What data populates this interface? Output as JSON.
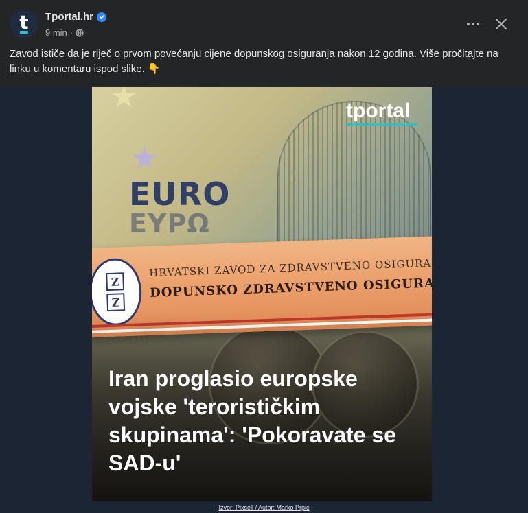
{
  "post": {
    "author": "Tportal.hr",
    "avatar_letter": "t",
    "time": "9 min",
    "audience": "globe-icon",
    "text": "Zavod ističe da je riječ o prvom povećanju cijene dopunskog osiguranja nakon 12 godina. Više pročitajte na linku u komentaru ispod slike. 👇",
    "more_label": "•••",
    "close_label": "×"
  },
  "image": {
    "brand": "tportal",
    "banknote_word": "EURO",
    "banknote_word_greek": "ΕΥΡΩ",
    "card_line1": "HRVATSKI ZAVOD ZA ZDRAVSTVENO OSIGURAN",
    "card_line2": "DOPUNSKO ZDRAVSTVENO OSIGURAN",
    "card_logo": [
      "Z",
      "Z"
    ],
    "headline": "Iran proglasio europske vojske 'terorističkim skupinama': 'Pokoravate se SAD-u'",
    "credit": "Izvor: Pixsell / Autor: Marko Prpic"
  },
  "colors": {
    "background": "#242526",
    "media_background": "#1c2533",
    "brand_accent": "#2bc1c9",
    "verified": "#2d88ff"
  }
}
